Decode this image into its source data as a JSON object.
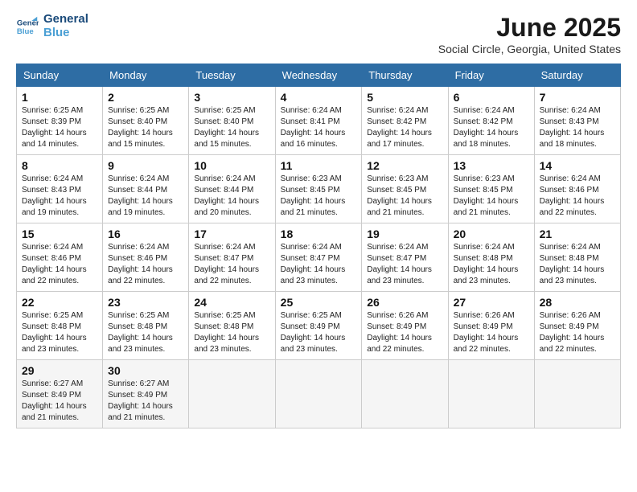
{
  "logo": {
    "line1": "General",
    "line2": "Blue"
  },
  "title": "June 2025",
  "location": "Social Circle, Georgia, United States",
  "days_header": [
    "Sunday",
    "Monday",
    "Tuesday",
    "Wednesday",
    "Thursday",
    "Friday",
    "Saturday"
  ],
  "weeks": [
    [
      {
        "day": "1",
        "sunrise": "Sunrise: 6:25 AM",
        "sunset": "Sunset: 8:39 PM",
        "daylight": "Daylight: 14 hours and 14 minutes."
      },
      {
        "day": "2",
        "sunrise": "Sunrise: 6:25 AM",
        "sunset": "Sunset: 8:40 PM",
        "daylight": "Daylight: 14 hours and 15 minutes."
      },
      {
        "day": "3",
        "sunrise": "Sunrise: 6:25 AM",
        "sunset": "Sunset: 8:40 PM",
        "daylight": "Daylight: 14 hours and 15 minutes."
      },
      {
        "day": "4",
        "sunrise": "Sunrise: 6:24 AM",
        "sunset": "Sunset: 8:41 PM",
        "daylight": "Daylight: 14 hours and 16 minutes."
      },
      {
        "day": "5",
        "sunrise": "Sunrise: 6:24 AM",
        "sunset": "Sunset: 8:42 PM",
        "daylight": "Daylight: 14 hours and 17 minutes."
      },
      {
        "day": "6",
        "sunrise": "Sunrise: 6:24 AM",
        "sunset": "Sunset: 8:42 PM",
        "daylight": "Daylight: 14 hours and 18 minutes."
      },
      {
        "day": "7",
        "sunrise": "Sunrise: 6:24 AM",
        "sunset": "Sunset: 8:43 PM",
        "daylight": "Daylight: 14 hours and 18 minutes."
      }
    ],
    [
      {
        "day": "8",
        "sunrise": "Sunrise: 6:24 AM",
        "sunset": "Sunset: 8:43 PM",
        "daylight": "Daylight: 14 hours and 19 minutes."
      },
      {
        "day": "9",
        "sunrise": "Sunrise: 6:24 AM",
        "sunset": "Sunset: 8:44 PM",
        "daylight": "Daylight: 14 hours and 19 minutes."
      },
      {
        "day": "10",
        "sunrise": "Sunrise: 6:24 AM",
        "sunset": "Sunset: 8:44 PM",
        "daylight": "Daylight: 14 hours and 20 minutes."
      },
      {
        "day": "11",
        "sunrise": "Sunrise: 6:23 AM",
        "sunset": "Sunset: 8:45 PM",
        "daylight": "Daylight: 14 hours and 21 minutes."
      },
      {
        "day": "12",
        "sunrise": "Sunrise: 6:23 AM",
        "sunset": "Sunset: 8:45 PM",
        "daylight": "Daylight: 14 hours and 21 minutes."
      },
      {
        "day": "13",
        "sunrise": "Sunrise: 6:23 AM",
        "sunset": "Sunset: 8:45 PM",
        "daylight": "Daylight: 14 hours and 21 minutes."
      },
      {
        "day": "14",
        "sunrise": "Sunrise: 6:24 AM",
        "sunset": "Sunset: 8:46 PM",
        "daylight": "Daylight: 14 hours and 22 minutes."
      }
    ],
    [
      {
        "day": "15",
        "sunrise": "Sunrise: 6:24 AM",
        "sunset": "Sunset: 8:46 PM",
        "daylight": "Daylight: 14 hours and 22 minutes."
      },
      {
        "day": "16",
        "sunrise": "Sunrise: 6:24 AM",
        "sunset": "Sunset: 8:46 PM",
        "daylight": "Daylight: 14 hours and 22 minutes."
      },
      {
        "day": "17",
        "sunrise": "Sunrise: 6:24 AM",
        "sunset": "Sunset: 8:47 PM",
        "daylight": "Daylight: 14 hours and 22 minutes."
      },
      {
        "day": "18",
        "sunrise": "Sunrise: 6:24 AM",
        "sunset": "Sunset: 8:47 PM",
        "daylight": "Daylight: 14 hours and 23 minutes."
      },
      {
        "day": "19",
        "sunrise": "Sunrise: 6:24 AM",
        "sunset": "Sunset: 8:47 PM",
        "daylight": "Daylight: 14 hours and 23 minutes."
      },
      {
        "day": "20",
        "sunrise": "Sunrise: 6:24 AM",
        "sunset": "Sunset: 8:48 PM",
        "daylight": "Daylight: 14 hours and 23 minutes."
      },
      {
        "day": "21",
        "sunrise": "Sunrise: 6:24 AM",
        "sunset": "Sunset: 8:48 PM",
        "daylight": "Daylight: 14 hours and 23 minutes."
      }
    ],
    [
      {
        "day": "22",
        "sunrise": "Sunrise: 6:25 AM",
        "sunset": "Sunset: 8:48 PM",
        "daylight": "Daylight: 14 hours and 23 minutes."
      },
      {
        "day": "23",
        "sunrise": "Sunrise: 6:25 AM",
        "sunset": "Sunset: 8:48 PM",
        "daylight": "Daylight: 14 hours and 23 minutes."
      },
      {
        "day": "24",
        "sunrise": "Sunrise: 6:25 AM",
        "sunset": "Sunset: 8:48 PM",
        "daylight": "Daylight: 14 hours and 23 minutes."
      },
      {
        "day": "25",
        "sunrise": "Sunrise: 6:25 AM",
        "sunset": "Sunset: 8:49 PM",
        "daylight": "Daylight: 14 hours and 23 minutes."
      },
      {
        "day": "26",
        "sunrise": "Sunrise: 6:26 AM",
        "sunset": "Sunset: 8:49 PM",
        "daylight": "Daylight: 14 hours and 22 minutes."
      },
      {
        "day": "27",
        "sunrise": "Sunrise: 6:26 AM",
        "sunset": "Sunset: 8:49 PM",
        "daylight": "Daylight: 14 hours and 22 minutes."
      },
      {
        "day": "28",
        "sunrise": "Sunrise: 6:26 AM",
        "sunset": "Sunset: 8:49 PM",
        "daylight": "Daylight: 14 hours and 22 minutes."
      }
    ],
    [
      {
        "day": "29",
        "sunrise": "Sunrise: 6:27 AM",
        "sunset": "Sunset: 8:49 PM",
        "daylight": "Daylight: 14 hours and 21 minutes."
      },
      {
        "day": "30",
        "sunrise": "Sunrise: 6:27 AM",
        "sunset": "Sunset: 8:49 PM",
        "daylight": "Daylight: 14 hours and 21 minutes."
      },
      null,
      null,
      null,
      null,
      null
    ]
  ]
}
